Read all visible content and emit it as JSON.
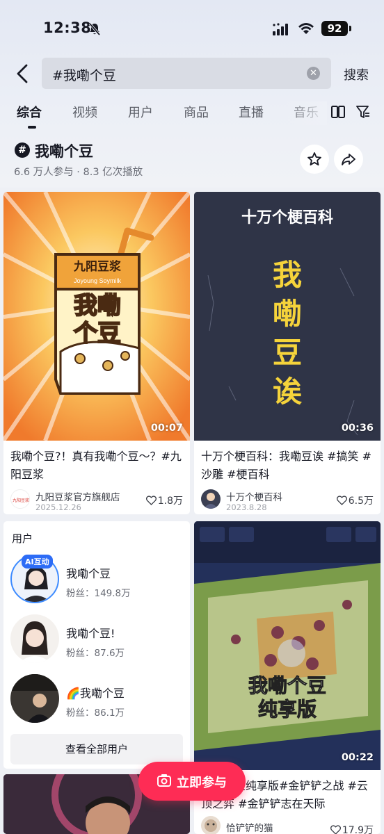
{
  "status_bar": {
    "time": "12:38",
    "battery": "92"
  },
  "search": {
    "query": "#我嘞个豆",
    "button": "搜索"
  },
  "tabs": [
    "综合",
    "视频",
    "用户",
    "商品",
    "直播",
    "音乐"
  ],
  "topic": {
    "badge": "#",
    "title": "我嘞个豆",
    "stats": "6.6 万人参与 · 8.3 亿次播放"
  },
  "videos": [
    {
      "thumb_brand": "九阳豆浆",
      "thumb_brand_en": "Joyoung Soymilk",
      "thumb_big": [
        "我嘞",
        "个豆"
      ],
      "duration": "00:07",
      "title": "我嘞个豆?！真有我嘞个豆～？#九阳豆浆",
      "author": "九阳豆浆官方旗舰店",
      "author_avatar_text": "九阳豆浆",
      "date": "2025.12.26",
      "likes": "1.8万"
    },
    {
      "thumb_header": "十万个梗百科",
      "thumb_big": [
        "我",
        "嘞",
        "豆",
        "诶"
      ],
      "duration": "00:36",
      "title": "十万个梗百科：我嘞豆诶 #搞笑 #沙雕 #梗百科",
      "author": "十万个梗百科",
      "date": "2023.8.28",
      "likes": "6.5万"
    },
    {
      "thumb_caption": [
        "我嘞个豆",
        "纯享版"
      ],
      "duration": "00:22",
      "title": "我嘞个豆纯享版#金铲铲之战 #云顶之弈 #金铲铲志在天际",
      "author": "恰铲铲的猫",
      "likes": "17.9万"
    }
  ],
  "users_section": {
    "header": "用户",
    "users": [
      {
        "name": "我嘞个豆",
        "fans": "粉丝：149.8万",
        "badge": "AI互动"
      },
      {
        "name": "我嘞个豆!",
        "fans": "粉丝：87.6万"
      },
      {
        "name": "我嘞个豆",
        "prefix": "🌈",
        "fans": "粉丝：86.1万"
      }
    ],
    "view_all": "查看全部用户"
  },
  "join_button": "立即参与",
  "colors": {
    "accent": "#fe2c55",
    "text": "#161823",
    "muted": "#6b6e77"
  }
}
